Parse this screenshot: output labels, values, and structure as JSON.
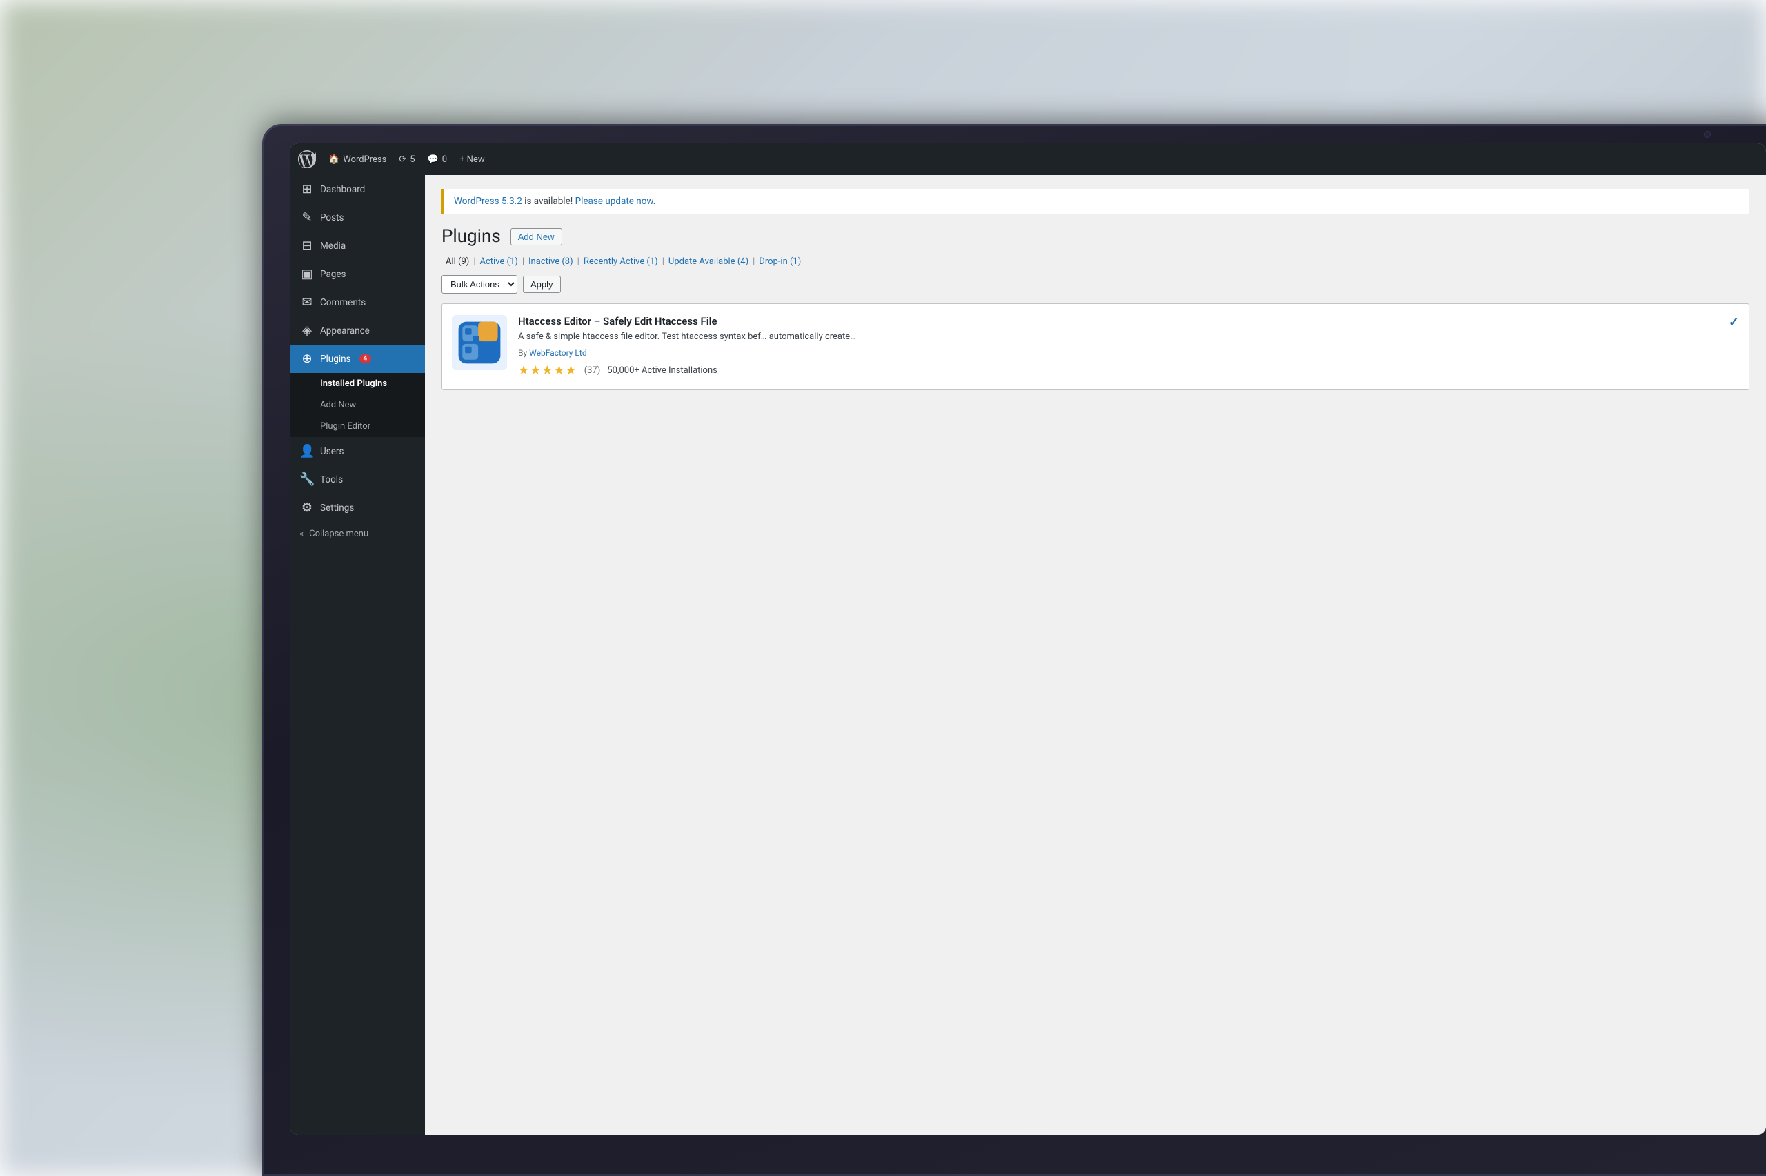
{
  "background": {
    "description": "blurred bokeh background"
  },
  "laptop": {
    "screen": {
      "adminBar": {
        "wpLogoAlt": "WordPress logo",
        "siteLabel": "WordPress",
        "updatesCount": "5",
        "commentsCount": "0",
        "newLabel": "+ New"
      },
      "sidebar": {
        "items": [
          {
            "id": "dashboard",
            "label": "Dashboard",
            "icon": "⊞",
            "badge": null
          },
          {
            "id": "posts",
            "label": "Posts",
            "icon": "✎",
            "badge": null
          },
          {
            "id": "media",
            "label": "Media",
            "icon": "⊟",
            "badge": null
          },
          {
            "id": "pages",
            "label": "Pages",
            "icon": "▣",
            "badge": null
          },
          {
            "id": "comments",
            "label": "Comments",
            "icon": "✉",
            "badge": null
          },
          {
            "id": "appearance",
            "label": "Appearance",
            "icon": "◈",
            "badge": null
          },
          {
            "id": "plugins",
            "label": "Plugins",
            "icon": "⊕",
            "badge": "4",
            "active": true
          }
        ],
        "pluginsSubmenu": [
          {
            "id": "installed-plugins",
            "label": "Installed Plugins",
            "active": true
          },
          {
            "id": "add-new",
            "label": "Add New"
          },
          {
            "id": "plugin-editor",
            "label": "Plugin Editor"
          }
        ],
        "bottomItems": [
          {
            "id": "users",
            "label": "Users",
            "icon": "👤"
          },
          {
            "id": "tools",
            "label": "Tools",
            "icon": "🔧"
          },
          {
            "id": "settings",
            "label": "Settings",
            "icon": "⊞"
          }
        ],
        "collapseLabel": "Collapse menu"
      },
      "content": {
        "updateNotice": {
          "version": "WordPress 5.3.2",
          "message": " is available! ",
          "linkText": "Please update now",
          "linkSuffix": "."
        },
        "pageTitle": "Plugins",
        "addNewButton": "Add New",
        "filterLinks": [
          {
            "label": "All",
            "count": "(9)",
            "id": "all"
          },
          {
            "label": "Active",
            "count": "(1)",
            "id": "active"
          },
          {
            "label": "Inactive",
            "count": "(8)",
            "id": "inactive"
          },
          {
            "label": "Recently Active",
            "count": "(1)",
            "id": "recently-active"
          },
          {
            "label": "Update Available",
            "count": "(4)",
            "id": "update-available"
          },
          {
            "label": "Drop-in",
            "count": "(1)",
            "id": "drop-in"
          }
        ],
        "bulkActions": {
          "selectLabel": "Bulk Actions",
          "applyLabel": "Apply"
        },
        "plugins": [
          {
            "id": "htaccess-editor",
            "name": "Htaccess Editor – Safely Edit Htaccess File",
            "description": "A safe & simple htaccess file editor. Test htaccess syntax bef… automatically create…",
            "author": "WebFactory Ltd",
            "stars": 5,
            "reviewCount": "(37)",
            "installCount": "50,000+ Active Installations",
            "hasCheckmark": true
          }
        ]
      }
    }
  }
}
